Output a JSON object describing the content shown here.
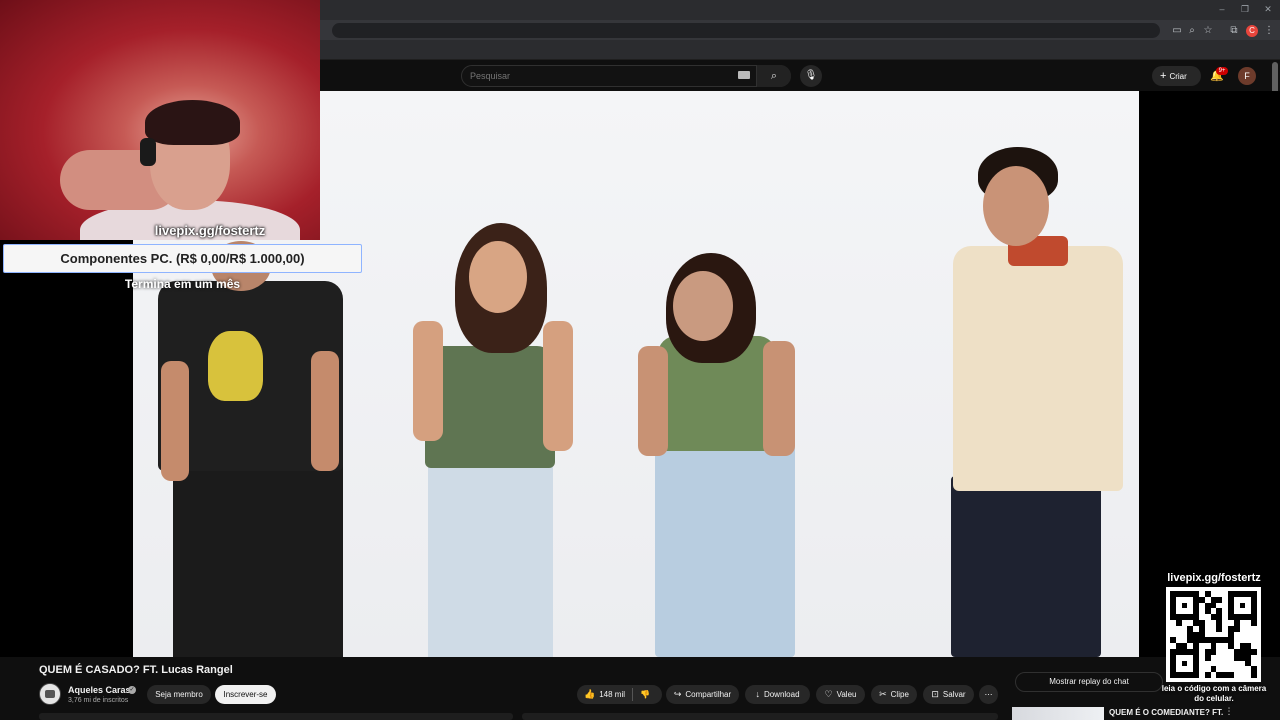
{
  "browser": {
    "window_controls": [
      "–",
      "❐",
      "✕"
    ],
    "profile_initial": "C"
  },
  "header": {
    "search_placeholder": "Pesquisar",
    "create_label": "Criar",
    "notifications_badge": "9+",
    "avatar_initial": "F"
  },
  "overlay": {
    "donation_url": "livepix.gg/fostertz",
    "goal_label": "Componentes PC. (R$ 0,00/R$ 1.000,00)",
    "goal_subtitle": "Termina em um mês",
    "qr_url": "livepix.gg/fostertz",
    "qr_caption": "leia o código com a câmera do celular."
  },
  "video": {
    "title": "QUEM É CASADO? FT. Lucas Rangel",
    "channel_name": "Aqueles Caras",
    "subscribers": "3,76 mi de inscritos",
    "member_label": "Seja membro",
    "subscribe_label": "Inscrever-se",
    "likes": "148 mil",
    "actions": {
      "share": "Compartilhar",
      "download": "Download",
      "thanks": "Valeu",
      "clip": "Clipe",
      "save": "Salvar"
    }
  },
  "sidebar": {
    "chat_replay_label": "Mostrar replay do chat",
    "recommended_title": "QUEM É O COMEDIANTE? FT."
  },
  "colors": {
    "background": "#0f0f0f",
    "accent_red": "#cc0000",
    "subscribe_bg": "#f1f1f1"
  }
}
